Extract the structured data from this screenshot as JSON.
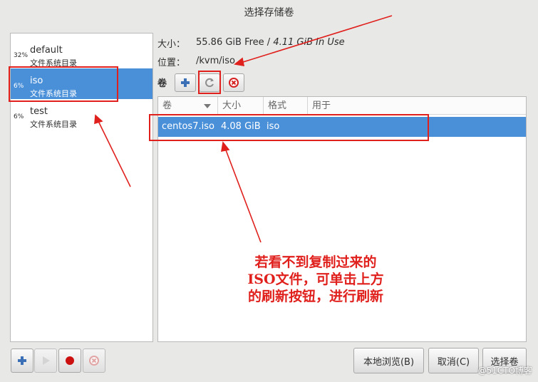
{
  "window": {
    "title": "选择存储卷"
  },
  "pools": [
    {
      "percent": "32%",
      "name": "default",
      "type": "文件系统目录"
    },
    {
      "percent": "6%",
      "name": "iso",
      "type": "文件系统目录",
      "selected": true
    },
    {
      "percent": "6%",
      "name": "test",
      "type": "文件系统目录"
    }
  ],
  "pool_info": {
    "size_label": "大小：",
    "size_free": "55.86 GiB Free /",
    "size_inuse": "4.11 GiB In Use",
    "location_label": "位置：",
    "location": "/kvm/iso"
  },
  "volumes": {
    "label": "卷",
    "columns": [
      "卷",
      "大小",
      "格式",
      "用于"
    ],
    "rows": [
      {
        "name": "centos7.iso",
        "size": "4.08 GiB",
        "format": "iso",
        "used_by": ""
      }
    ]
  },
  "buttons": {
    "browse_local": "本地浏览(B)",
    "cancel": "取消(C)",
    "choose_volume": "选择卷"
  },
  "annotation": {
    "lines": [
      "若看不到复制过来的",
      "ISO文件，可单击上方",
      "的刷新按钮，进行刷新"
    ],
    "color": "#e0201c"
  },
  "watermark": "@51CTO博客",
  "colors": {
    "selection": "#4a90d9",
    "annotation": "#e0201c"
  }
}
